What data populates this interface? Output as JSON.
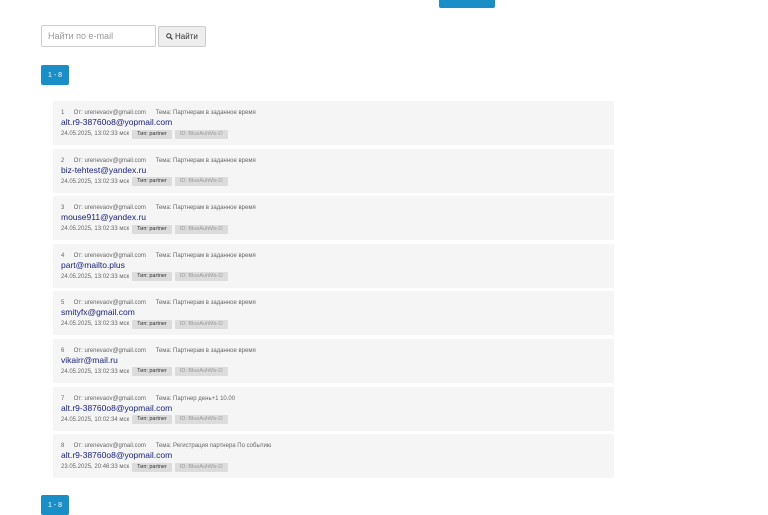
{
  "header": {
    "top_button_label": ""
  },
  "search": {
    "placeholder": "Найти по e-mail",
    "value": "",
    "button_label": "Найти",
    "button_icon": "search-icon"
  },
  "pager": {
    "label": "1 - 8"
  },
  "labels": {
    "from_prefix": "От:",
    "subject_prefix": "Тема:",
    "type_prefix": "Тип:",
    "id_prefix": "ID:"
  },
  "items": [
    {
      "num": "1",
      "from": "urenevaov@gmail.com",
      "subject": "Партнерам в заданное время",
      "email": "alt.r9-38760o8@yopmail.com",
      "date": "24.05.2025, 13:02:33 мск",
      "type": "partner",
      "id": "BlueAuhMs-O"
    },
    {
      "num": "2",
      "from": "urenevaov@gmail.com",
      "subject": "Партнерам в заданное время",
      "email": "biz-tehtest@yandex.ru",
      "date": "24.05.2025, 13:02:33 мск",
      "type": "partner",
      "id": "BlueAuhMs-O"
    },
    {
      "num": "3",
      "from": "urenevaov@gmail.com",
      "subject": "Партнерам в заданное время",
      "email": "mouse911@yandex.ru",
      "date": "24.05.2025, 13:02:33 мск",
      "type": "partner",
      "id": "BlueAuhMs-O"
    },
    {
      "num": "4",
      "from": "urenevaov@gmail.com",
      "subject": "Партнерам в заданное время",
      "email": "part@mailto.plus",
      "date": "24.05.2025, 13:02:33 мск",
      "type": "partner",
      "id": "BlueAuhMs-O"
    },
    {
      "num": "5",
      "from": "urenevaov@gmail.com",
      "subject": "Партнерам в заданное время",
      "email": "smityfx@gmail.com",
      "date": "24.05.2025, 13:02:33 мск",
      "type": "partner",
      "id": "BlueAuhMs-O"
    },
    {
      "num": "6",
      "from": "urenevaov@gmail.com",
      "subject": "Партнерам в заданное время",
      "email": "vikairr@mail.ru",
      "date": "24.05.2025, 13:02:33 мск",
      "type": "partner",
      "id": "BlueAuhMs-O"
    },
    {
      "num": "7",
      "from": "urenevaov@gmail.com",
      "subject": "Партнер день+1 10.00",
      "email": "alt.r9-38760o8@yopmail.com",
      "date": "24.05.2025, 10:02:34 мск",
      "type": "partner",
      "id": "BlueAuhMs-O"
    },
    {
      "num": "8",
      "from": "urenevaov@gmail.com",
      "subject": "Регистрация партнера По событию",
      "email": "alt.r9-38760o8@yopmail.com",
      "date": "23.05.2025, 20:46:33 мск",
      "type": "partner",
      "id": "BlueAuhMs-O"
    }
  ]
}
